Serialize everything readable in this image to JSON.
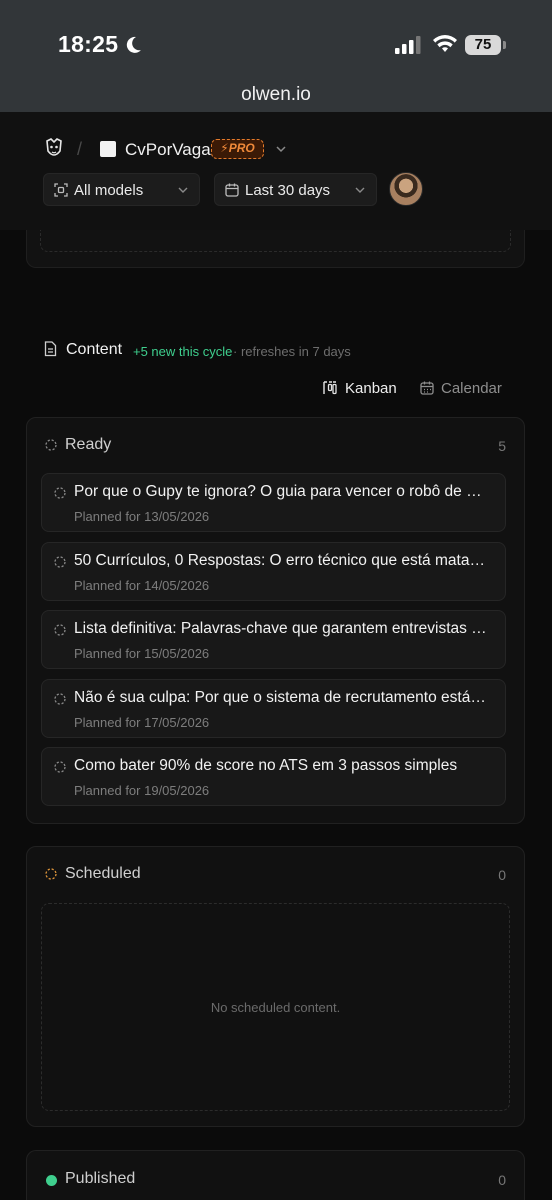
{
  "status_bar": {
    "time": "18:25",
    "battery": "75"
  },
  "browser": {
    "url": "olwen.io"
  },
  "header": {
    "project_name": "CvPorVaga",
    "plan_badge": "⚡PRO",
    "models_select": "All models",
    "range_select": "Last 30 days"
  },
  "content": {
    "title": "Content",
    "new_count": "+5 new this cycle",
    "refresh": "· refreshes in 7 days",
    "views": {
      "kanban": "Kanban",
      "calendar": "Calendar"
    }
  },
  "columns": {
    "ready": {
      "title": "Ready",
      "count": "5",
      "items": [
        {
          "title": "Por que o Gupy te ignora? O guia para vencer o robô de u…",
          "date": "Planned for 13/05/2026"
        },
        {
          "title": "50 Currículos, 0 Respostas: O erro técnico que está mata…",
          "date": "Planned for 14/05/2026"
        },
        {
          "title": "Lista definitiva: Palavras-chave que garantem entrevistas …",
          "date": "Planned for 15/05/2026"
        },
        {
          "title": "Não é sua culpa: Por que o sistema de recrutamento está …",
          "date": "Planned for 17/05/2026"
        },
        {
          "title": "Como bater 90% de score no ATS em 3 passos simples",
          "date": "Planned for 19/05/2026"
        }
      ]
    },
    "scheduled": {
      "title": "Scheduled",
      "count": "0",
      "empty": "No scheduled content."
    },
    "published": {
      "title": "Published",
      "count": "0"
    }
  },
  "colors": {
    "accent_green": "#3fcf8e",
    "pro_orange": "#e37b2c",
    "scheduled_orange": "#e0963a"
  },
  "icons": [
    "moon-icon",
    "signal-icon",
    "wifi-icon",
    "logo-icon",
    "layers-icon",
    "calendar-icon",
    "chevron-down-icon",
    "document-icon",
    "kanban-icon",
    "dashed-circle-icon"
  ]
}
